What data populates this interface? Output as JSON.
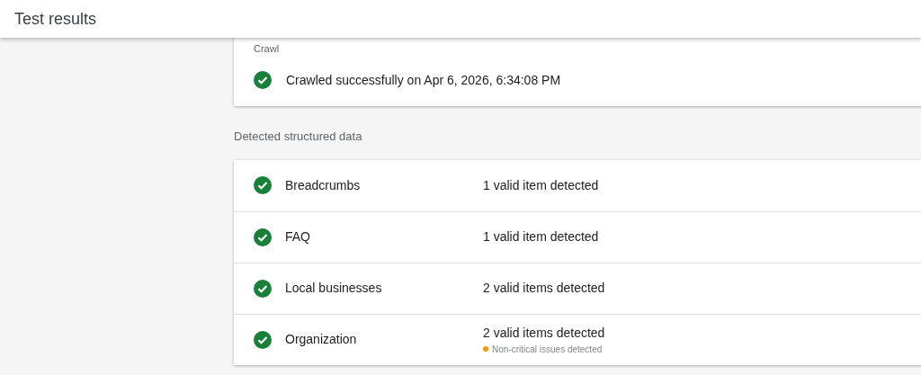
{
  "header": {
    "title": "Test results"
  },
  "crawl": {
    "label": "Crawl",
    "message": "Crawled successfully on Apr 6, 2026, 6:34:08 PM"
  },
  "structured_data": {
    "heading": "Detected structured data",
    "rows": [
      {
        "name": "Breadcrumbs",
        "result": "1 valid item detected"
      },
      {
        "name": "FAQ",
        "result": "1 valid item detected"
      },
      {
        "name": "Local businesses",
        "result": "2 valid items detected"
      },
      {
        "name": "Organization",
        "result": "2 valid items detected",
        "note": {
          "text": "Non-critical issues detected",
          "color": "#f29900"
        }
      }
    ]
  }
}
